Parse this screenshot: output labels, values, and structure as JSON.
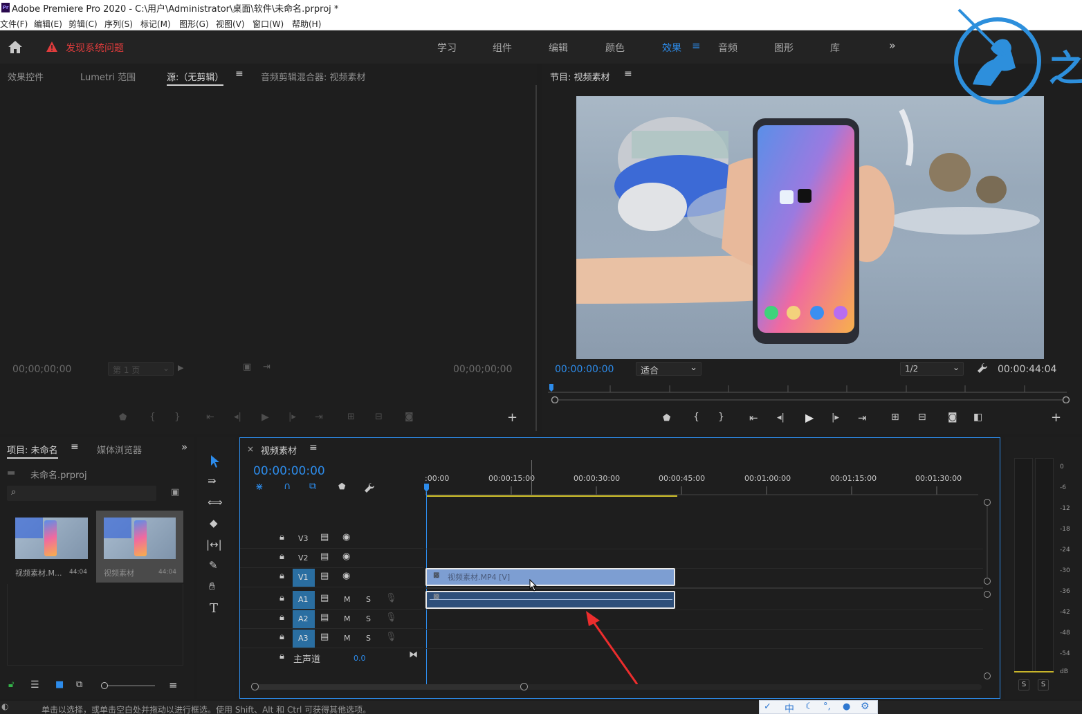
{
  "window": {
    "title": "Adobe Premiere Pro 2020 - C:\\用户\\Administrator\\桌面\\软件\\未命名.prproj *",
    "app_icon": "Pr"
  },
  "menubar": [
    "文件(F)",
    "编辑(E)",
    "剪辑(C)",
    "序列(S)",
    "标记(M)",
    "图形(G)",
    "视图(V)",
    "窗口(W)",
    "帮助(H)"
  ],
  "header": {
    "alert": "发现系统问题",
    "workspaces": [
      "学习",
      "组件",
      "编辑",
      "颜色",
      "效果",
      "音频",
      "图形",
      "库"
    ],
    "active_workspace": "效果",
    "more": "»"
  },
  "source_panel": {
    "tabs": [
      "效果控件",
      "Lumetri 范围",
      "源:（无剪辑）",
      "音频剪辑混合器: 视频素材"
    ],
    "active_tab": "源:（无剪辑）",
    "timecode_left": "00;00;00;00",
    "page_select": "第 1 页",
    "timecode_right": "00;00;00;00"
  },
  "program_panel": {
    "title": "节目: 视频素材",
    "timecode": "00:00:00:00",
    "fit": "适合",
    "resolution": "1/2",
    "duration": "00:00:44:04"
  },
  "project_panel": {
    "tab": "项目: 未命名",
    "tab2": "媒体浏览器",
    "more": "»",
    "file": "未命名.prproj",
    "items": [
      {
        "name": "视频素材.M...",
        "duration": "44:04"
      },
      {
        "name": "视频素材",
        "duration": "44:04"
      }
    ]
  },
  "timeline": {
    "title": "视频素材",
    "timecode": "00:00:00:00",
    "ruler": [
      ":00:00",
      "00:00:15:00",
      "00:00:30:00",
      "00:00:45:00",
      "00:01:00:00",
      "00:01:15:00",
      "00:01:30:00"
    ],
    "video_tracks": [
      "V3",
      "V2",
      "V1"
    ],
    "audio_tracks": [
      "A1",
      "A2",
      "A3"
    ],
    "master": "主声道",
    "master_value": "0.0",
    "clip_label": "视频素材.MP4 [V]",
    "mute": "M",
    "solo": "S"
  },
  "meter": {
    "scale": [
      "0",
      "-6",
      "-12",
      "-18",
      "-24",
      "-30",
      "-36",
      "-42",
      "-48",
      "-54",
      "dB"
    ],
    "solo": [
      "S",
      "S"
    ]
  },
  "statusbar": {
    "text": "单击以选择，或单击空白处并拖动以进行框选。使用 Shift、Alt 和 Ctrl 可获得其他选项。"
  },
  "ime": {
    "label": "中"
  },
  "watermark": {
    "text": "之"
  },
  "colors": {
    "accent": "#2d8ceb",
    "alert": "#e03c3c",
    "clip_video": "#7d9ed2",
    "clip_audio": "#2e4f7a",
    "track_active": "#2a6ea1"
  }
}
